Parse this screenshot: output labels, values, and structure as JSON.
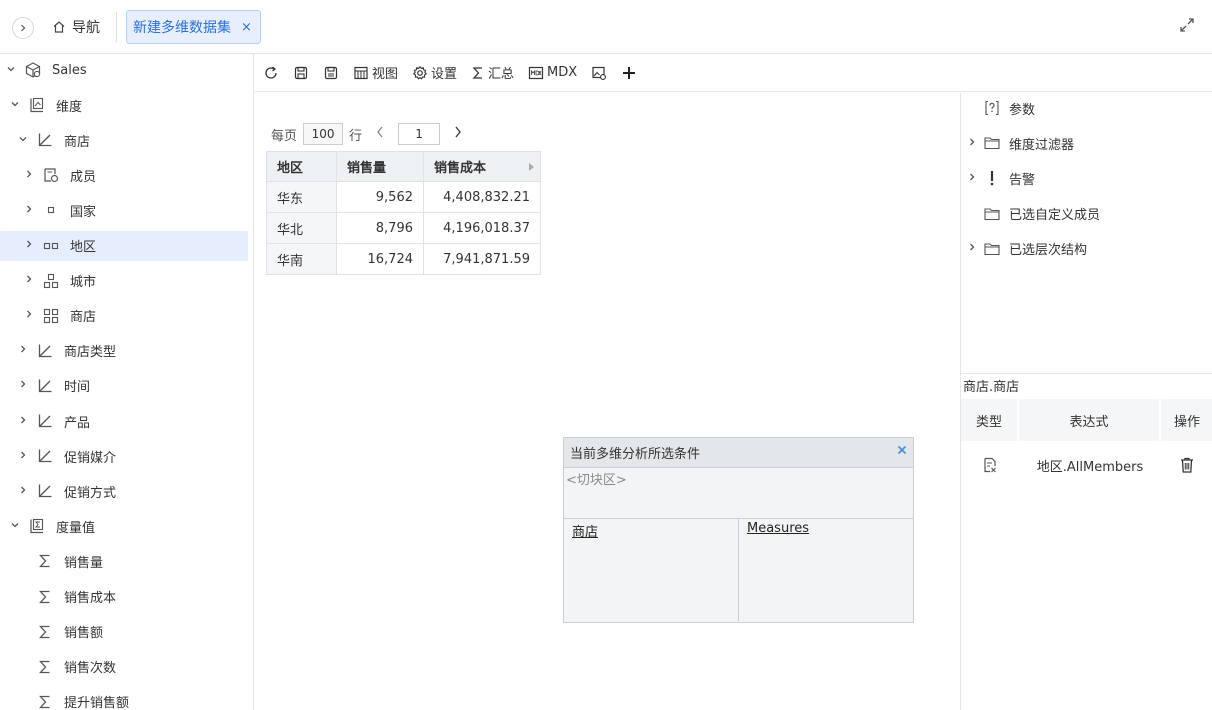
{
  "header": {
    "nav_label": "导航",
    "tab_label": "新建多维数据集",
    "tab_close": "×"
  },
  "sidebar": {
    "items": [
      {
        "label": "Sales",
        "level": 0,
        "expanded": true,
        "icon": "cube-icon"
      },
      {
        "label": "维度",
        "level": 1,
        "expanded": true,
        "icon": "dimension-folder-icon"
      },
      {
        "label": "商店",
        "level": 2,
        "expanded": true,
        "icon": "axis-icon"
      },
      {
        "label": "成员",
        "level": 3,
        "expanded": false,
        "icon": "member-icon"
      },
      {
        "label": "国家",
        "level": 3,
        "expanded": false,
        "icon": "level1-icon"
      },
      {
        "label": "地区",
        "level": 3,
        "expanded": false,
        "icon": "level2-icon",
        "selected": true
      },
      {
        "label": "城市",
        "level": 3,
        "expanded": false,
        "icon": "level3-icon"
      },
      {
        "label": "商店",
        "level": 3,
        "expanded": false,
        "icon": "level4-icon"
      },
      {
        "label": "商店类型",
        "level": 2,
        "expanded": false,
        "icon": "axis-icon"
      },
      {
        "label": "时间",
        "level": 2,
        "expanded": false,
        "icon": "axis-icon"
      },
      {
        "label": "产品",
        "level": 2,
        "expanded": false,
        "icon": "axis-icon"
      },
      {
        "label": "促销媒介",
        "level": 2,
        "expanded": false,
        "icon": "axis-icon"
      },
      {
        "label": "促销方式",
        "level": 2,
        "expanded": false,
        "icon": "axis-icon"
      },
      {
        "label": "度量值",
        "level": 1,
        "expanded": true,
        "icon": "measure-folder-icon"
      },
      {
        "label": "销售量",
        "level": 2,
        "leaf": true,
        "icon": "sigma-icon"
      },
      {
        "label": "销售成本",
        "level": 2,
        "leaf": true,
        "icon": "sigma-icon"
      },
      {
        "label": "销售额",
        "level": 2,
        "leaf": true,
        "icon": "sigma-icon"
      },
      {
        "label": "销售次数",
        "level": 2,
        "leaf": true,
        "icon": "sigma-icon"
      },
      {
        "label": "提升销售额",
        "level": 2,
        "leaf": true,
        "icon": "sigma-icon"
      }
    ]
  },
  "toolbar": {
    "view_label": "视图",
    "settings_label": "设置",
    "summary_label": "汇总",
    "mdx_label": "MDX"
  },
  "pager": {
    "per_page_label": "每页",
    "page_size": "100",
    "rows_label": "行",
    "current_page": "1"
  },
  "table": {
    "headers": [
      "地区",
      "销售量",
      "销售成本"
    ],
    "rows": [
      [
        "华东",
        "9,562",
        "4,408,832.21"
      ],
      [
        "华北",
        "8,796",
        "4,196,018.37"
      ],
      [
        "华南",
        "16,724",
        "7,941,871.59"
      ]
    ]
  },
  "condition_panel": {
    "title": "当前多维分析所选条件",
    "slice_label": "<切块区>",
    "row_field": "商店",
    "column_field": "Measures"
  },
  "right_panel": {
    "items": [
      {
        "label": "参数",
        "expandable": false,
        "icon": "param-icon"
      },
      {
        "label": "维度过滤器",
        "expandable": true,
        "icon": "folder-icon"
      },
      {
        "label": "告警",
        "expandable": true,
        "icon": "alert-icon"
      },
      {
        "label": "已选自定义成员",
        "expandable": false,
        "icon": "folder-icon"
      },
      {
        "label": "已选层次结构",
        "expandable": true,
        "icon": "folder-icon"
      }
    ],
    "section_title": "商店.商店",
    "table_headers": [
      "类型",
      "表达式",
      "操作"
    ],
    "row_expression": "地区.AllMembers"
  }
}
